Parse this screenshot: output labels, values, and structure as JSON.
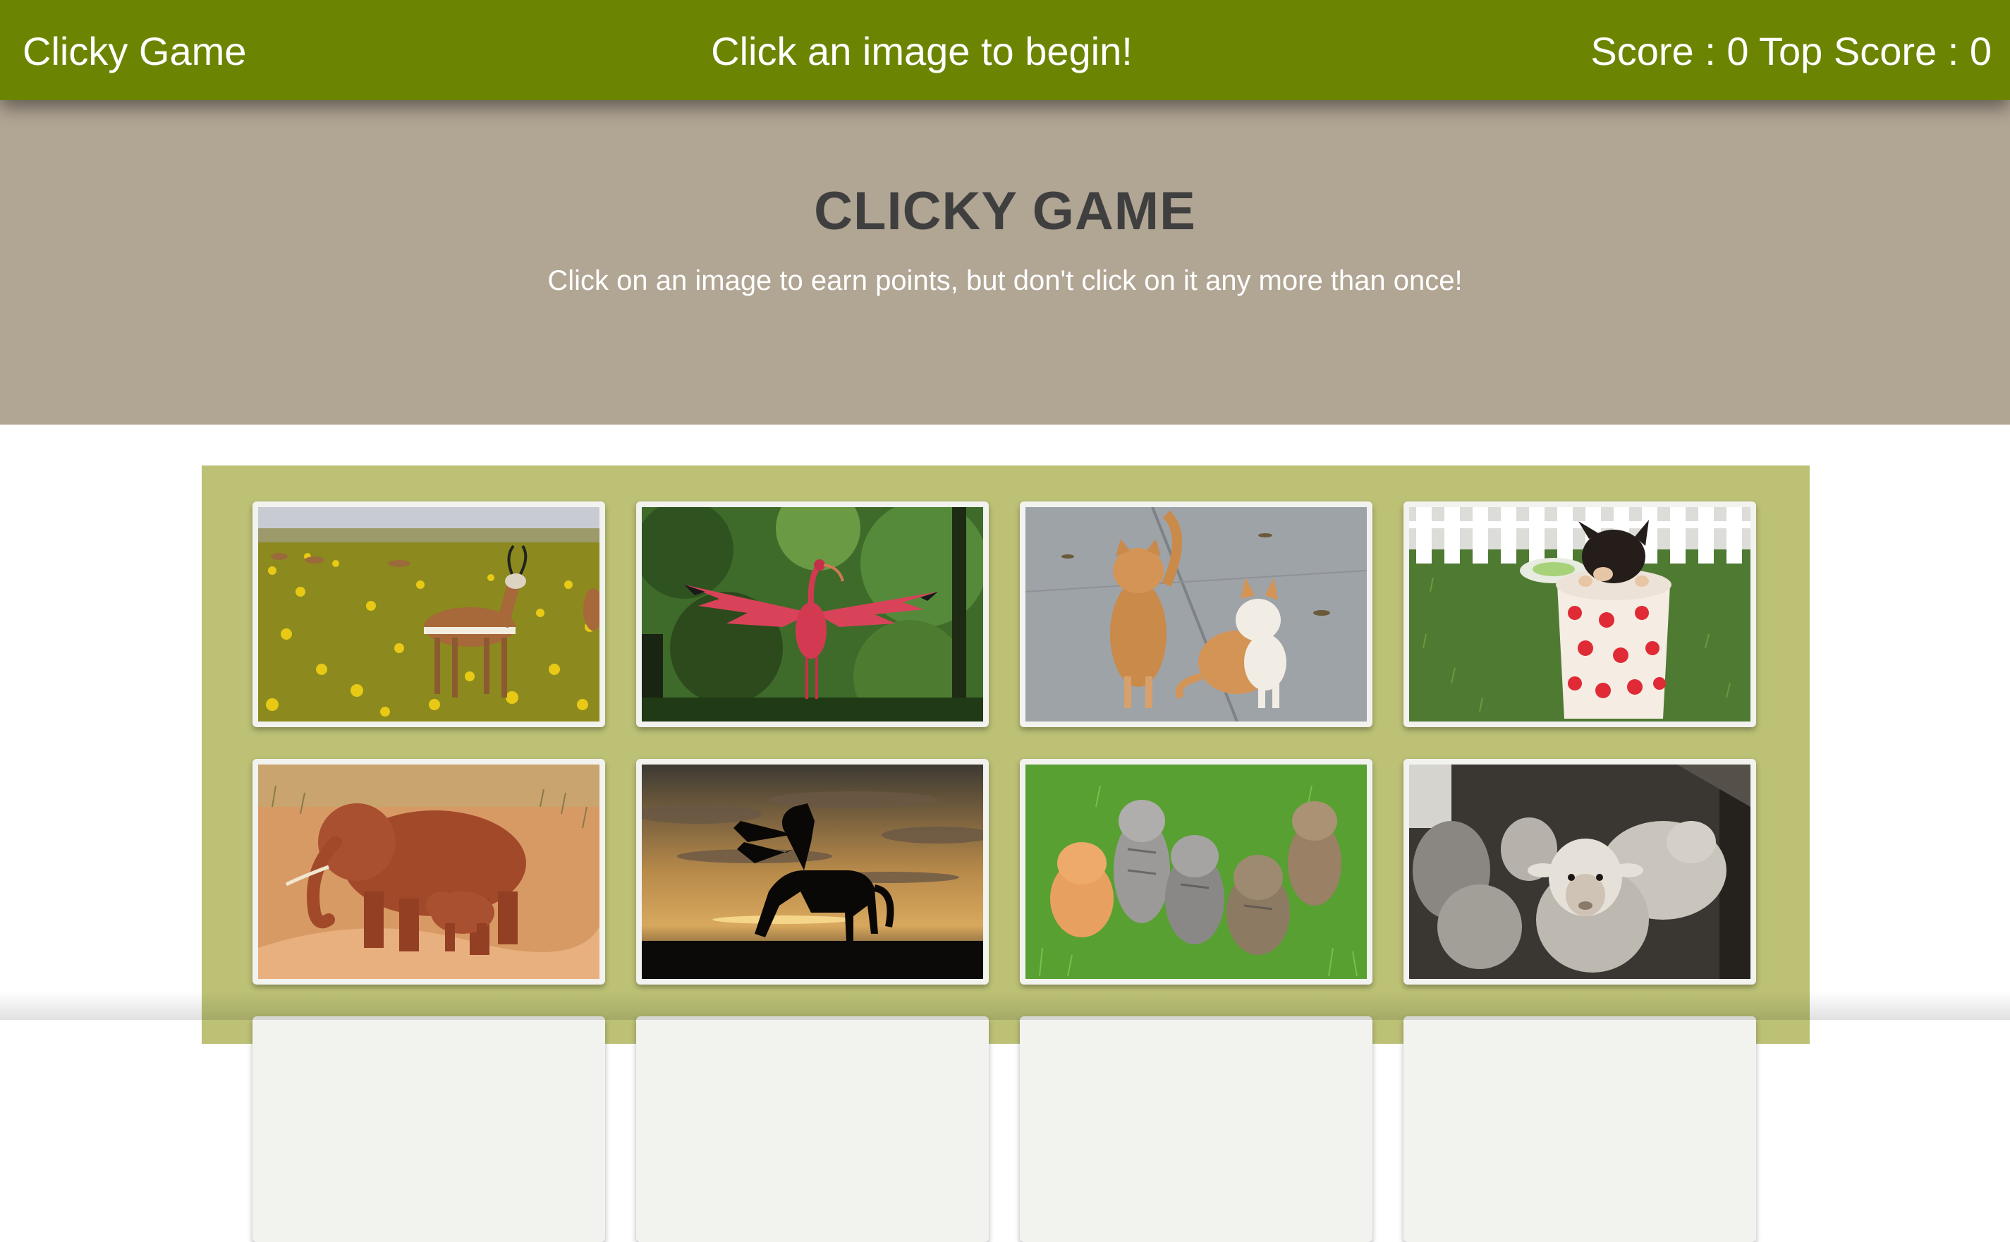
{
  "navbar": {
    "brand": "Clicky Game",
    "message": "Click an image to begin!",
    "score_text": "Score : 0 Top Score : 0",
    "background": "#6b8503"
  },
  "jumbotron": {
    "title": "CLICKY GAME",
    "subtitle": "Click on an image to earn points, but don't click on it any more than once!",
    "background": "#b1a594"
  },
  "board": {
    "background": "#bcc175",
    "cards": [
      {
        "name": "gazelle",
        "icon": "gazelle-photo"
      },
      {
        "name": "scarlet-ibis",
        "icon": "ibis-photo"
      },
      {
        "name": "two-cats",
        "icon": "cats-photo"
      },
      {
        "name": "puppy-in-cup",
        "icon": "puppy-photo"
      },
      {
        "name": "elephants",
        "icon": "elephant-photo"
      },
      {
        "name": "horse-silhouette",
        "icon": "horse-photo"
      },
      {
        "name": "kittens",
        "icon": "kittens-photo"
      },
      {
        "name": "sheep",
        "icon": "sheep-photo"
      }
    ]
  }
}
